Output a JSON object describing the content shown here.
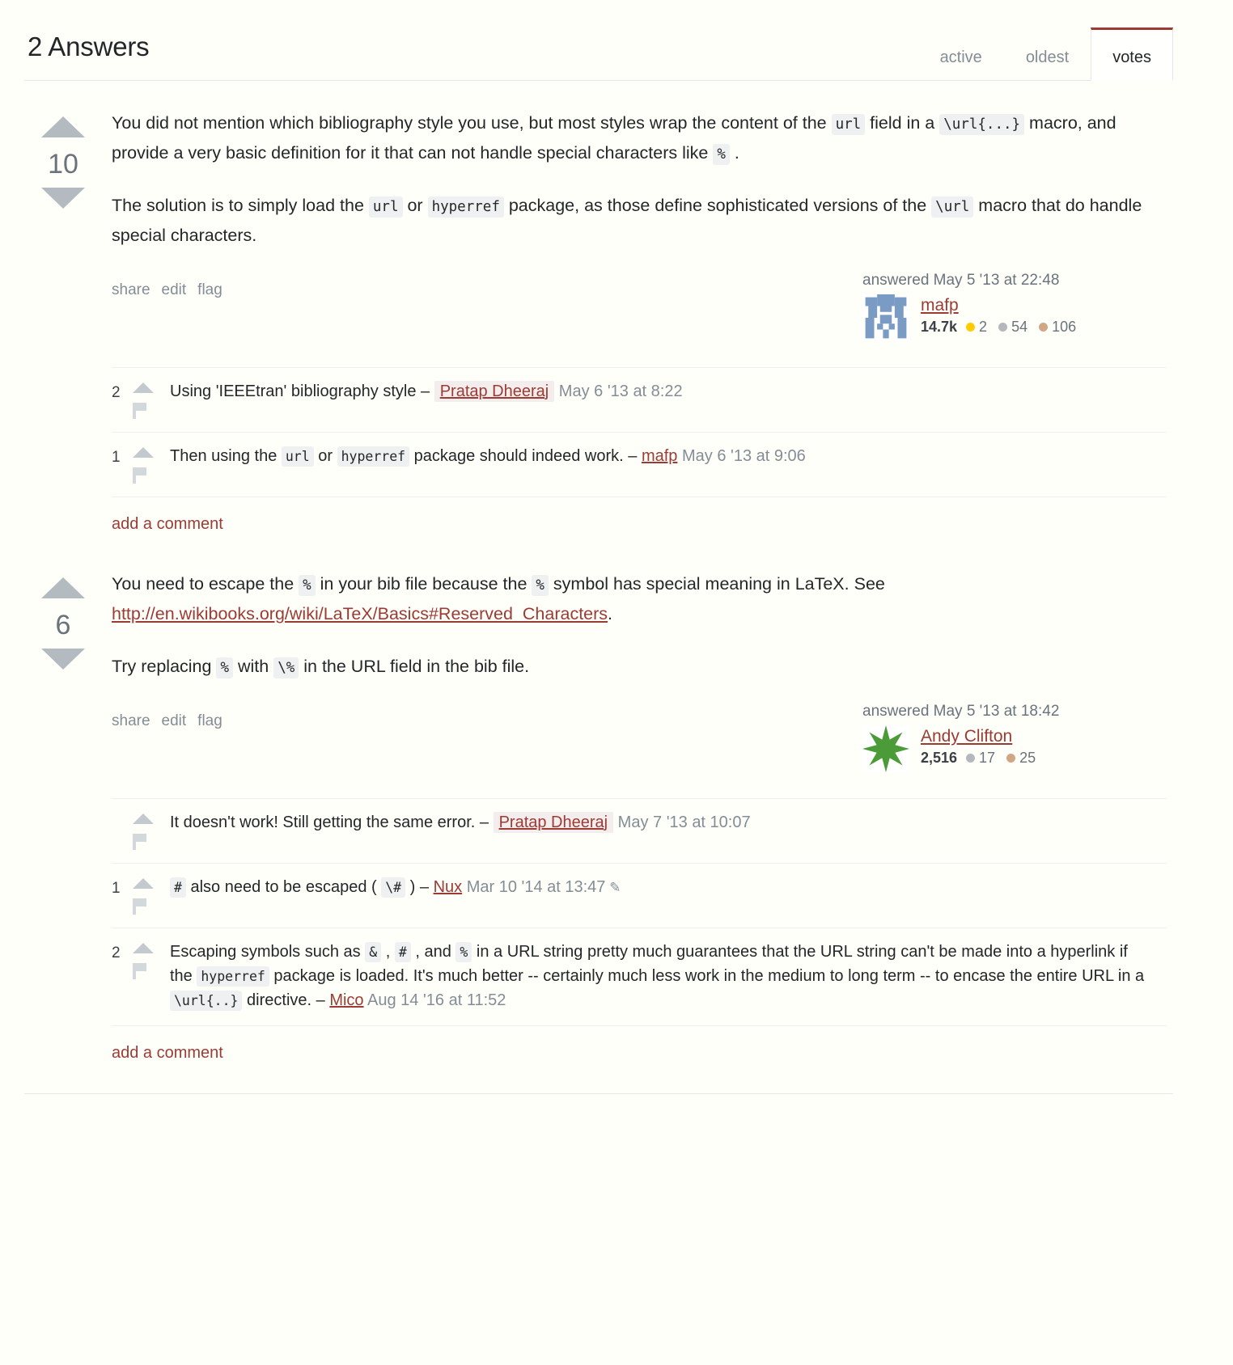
{
  "header": {
    "title": "2 Answers",
    "tabs": [
      {
        "label": "active",
        "selected": false
      },
      {
        "label": "oldest",
        "selected": false
      },
      {
        "label": "votes",
        "selected": true
      }
    ]
  },
  "colors": {
    "accent": "#9c3b34",
    "link": "#9c3b34",
    "muted": "#848d95",
    "code_bg": "#eff0f1",
    "gold": "#ffcc01",
    "silver": "#b4b8bc",
    "bronze": "#d1a684",
    "arrow": "#b4bbc0"
  },
  "answers": [
    {
      "score": "10",
      "paragraphs": [
        [
          {
            "t": "text",
            "v": "You did not mention which bibliography style you use, but most styles wrap the content of the "
          },
          {
            "t": "code",
            "v": "url"
          },
          {
            "t": "text",
            "v": " field in a "
          },
          {
            "t": "code",
            "v": "\\url{...}"
          },
          {
            "t": "text",
            "v": " macro, and provide a very basic definition for it that can not handle special characters like "
          },
          {
            "t": "code",
            "v": "%"
          },
          {
            "t": "text",
            "v": " ."
          }
        ],
        [
          {
            "t": "text",
            "v": "The solution is to simply load the "
          },
          {
            "t": "code",
            "v": "url"
          },
          {
            "t": "text",
            "v": " or "
          },
          {
            "t": "code",
            "v": "hyperref"
          },
          {
            "t": "text",
            "v": " package, as those define sophisticated versions of the "
          },
          {
            "t": "code",
            "v": "\\url"
          },
          {
            "t": "text",
            "v": " macro that do handle special characters."
          }
        ]
      ],
      "menu": [
        "share",
        "edit",
        "flag"
      ],
      "user": {
        "action_time": "answered May 5 '13 at 22:48",
        "name": "mafp",
        "reputation": "14.7k",
        "badges": {
          "gold": "2",
          "silver": "54",
          "bronze": "106"
        },
        "avatar_kind": "identicon-blue"
      },
      "comments": [
        {
          "score": "2",
          "parts": [
            {
              "t": "text",
              "v": "Using 'IEEEtran' bibliography style"
            }
          ],
          "dash": "–",
          "user": "Pratap Dheeraj",
          "user_highlight": true,
          "date": "May 6 '13 at 8:22",
          "edit_pencil": false
        },
        {
          "score": "1",
          "parts": [
            {
              "t": "text",
              "v": "Then using the "
            },
            {
              "t": "code",
              "v": "url"
            },
            {
              "t": "text",
              "v": " or "
            },
            {
              "t": "code",
              "v": "hyperref"
            },
            {
              "t": "text",
              "v": " package should indeed work."
            }
          ],
          "dash": "–",
          "user": "mafp",
          "user_highlight": false,
          "date": "May 6 '13 at 9:06",
          "edit_pencil": false
        }
      ],
      "add_comment_label": "add a comment"
    },
    {
      "score": "6",
      "paragraphs": [
        [
          {
            "t": "text",
            "v": "You need to escape the "
          },
          {
            "t": "code",
            "v": "%"
          },
          {
            "t": "text",
            "v": " in your bib file because the "
          },
          {
            "t": "code",
            "v": "%"
          },
          {
            "t": "text",
            "v": " symbol has special meaning in LaTeX. See "
          },
          {
            "t": "link",
            "v": "http://en.wikibooks.org/wiki/LaTeX/Basics#Reserved_Characters"
          },
          {
            "t": "text",
            "v": "."
          }
        ],
        [
          {
            "t": "text",
            "v": "Try replacing "
          },
          {
            "t": "code",
            "v": "%"
          },
          {
            "t": "text",
            "v": " with "
          },
          {
            "t": "code",
            "v": "\\%"
          },
          {
            "t": "text",
            "v": " in the URL field in the bib file."
          }
        ]
      ],
      "menu": [
        "share",
        "edit",
        "flag"
      ],
      "user": {
        "action_time": "answered May 5 '13 at 18:42",
        "name": "Andy Clifton",
        "reputation": "2,516",
        "badges": {
          "silver": "17",
          "bronze": "25"
        },
        "avatar_kind": "green-star"
      },
      "comments": [
        {
          "score": "",
          "parts": [
            {
              "t": "text",
              "v": "It doesn't work! Still getting the same error."
            }
          ],
          "dash": "–",
          "user": "Pratap Dheeraj",
          "user_highlight": true,
          "date": "May 7 '13 at 10:07",
          "edit_pencil": false
        },
        {
          "score": "1",
          "parts": [
            {
              "t": "code",
              "v": "#"
            },
            {
              "t": "text",
              "v": " also need to be escaped ( "
            },
            {
              "t": "code",
              "v": "\\#"
            },
            {
              "t": "text",
              "v": " )"
            }
          ],
          "dash": "–",
          "user": "Nux",
          "user_highlight": false,
          "date": "Mar 10 '14 at 13:47",
          "edit_pencil": true
        },
        {
          "score": "2",
          "parts": [
            {
              "t": "text",
              "v": "Escaping symbols such as "
            },
            {
              "t": "code",
              "v": "&"
            },
            {
              "t": "text",
              "v": " , "
            },
            {
              "t": "code",
              "v": "#"
            },
            {
              "t": "text",
              "v": " , and "
            },
            {
              "t": "code",
              "v": "%"
            },
            {
              "t": "text",
              "v": " in a URL string pretty much guarantees that the URL string can't be made into a hyperlink if the "
            },
            {
              "t": "code",
              "v": "hyperref"
            },
            {
              "t": "text",
              "v": " package is loaded. It's much better -- certainly much less work in the medium to long term -- to encase the entire URL in a "
            },
            {
              "t": "code",
              "v": "\\url{..}"
            },
            {
              "t": "text",
              "v": " directive."
            }
          ],
          "dash": "–",
          "user": "Mico",
          "user_highlight": false,
          "date": "Aug 14 '16 at 11:52",
          "edit_pencil": false
        }
      ],
      "add_comment_label": "add a comment"
    }
  ]
}
